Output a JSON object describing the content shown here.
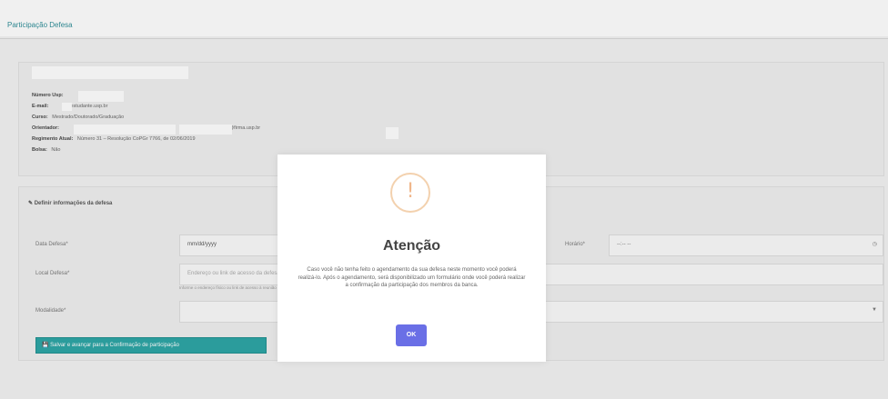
{
  "page": {
    "title": "Participação Defesa"
  },
  "student": {
    "numero_usp_label": "Número Usp:",
    "email_label": "E-mail:",
    "email_value": "@estudante.usp.br",
    "curso_label": "Curso:",
    "curso_value": "Mestrado/Doutorado/Graduação",
    "orientador_label": "Orientador:",
    "orientador_suffix": "@firma.usp.br",
    "regimento_label": "Regimento Atual:",
    "regimento_value": "Número 31 – Resolução CoPGr 7766, de 02/06/2019",
    "bolsa_label": "Bolsa:",
    "bolsa_value": "Não"
  },
  "defense": {
    "section_title": "Definir informações da defesa",
    "date_label": "Data Defesa*",
    "date_value": "mm/dd/yyyy",
    "time_label": "Horário*",
    "time_value": "--:-- --",
    "location_label": "Local Defesa*",
    "location_placeholder": "Endereço ou link de acesso da defesa",
    "location_hint": "Informe o endereço físico ou link de acesso à reunião virtual",
    "mode_label": "Modalidade*",
    "submit_label": "Salvar e avançar para a Confirmação de participação"
  },
  "modal": {
    "icon": "exclamation-icon",
    "icon_char": "!",
    "title": "Atenção",
    "message": "Caso você não tenha feito o agendamento da sua defesa neste momento você poderá realizá-lo. Após o agendamento, será disponibilizado um formulário onde você poderá realizar a confirmação da participação dos membros da banca.",
    "ok_label": "OK"
  },
  "colors": {
    "accent": "#2aa4a4",
    "modal_button": "#6a6fe6",
    "warning": "#f0b68a"
  }
}
